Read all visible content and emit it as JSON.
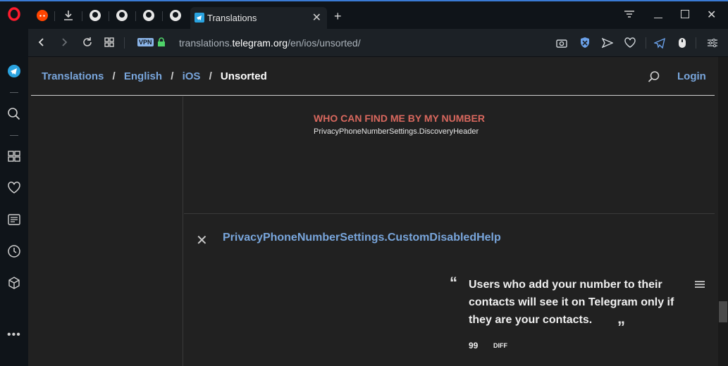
{
  "browser": {
    "tab_title": "Translations",
    "url_prefix": "translations.",
    "url_domain": "telegram.org",
    "url_path": "/en/ios/unsorted/",
    "vpn_label": "VPN"
  },
  "page": {
    "breadcrumb": [
      {
        "label": "Translations",
        "kind": "link"
      },
      {
        "label": "English",
        "kind": "link"
      },
      {
        "label": "iOS",
        "kind": "link"
      },
      {
        "label": "Unsorted",
        "kind": "current"
      }
    ],
    "breadcrumb_sep": "/",
    "login_label": "Login",
    "header_entry": {
      "title": "WHO CAN FIND ME BY MY NUMBER",
      "key": "PrivacyPhoneNumberSettings.DiscoveryHeader"
    },
    "entry": {
      "key": "PrivacyPhoneNumberSettings.CustomDisabledHelp",
      "quote_open": "“",
      "quote_close": "”",
      "text": "Users who add your number to their contacts will see it on Telegram only if they are your contacts.",
      "votes": "99",
      "diff_label": "DIFF"
    }
  },
  "colors": {
    "link": "#79a6dc",
    "header_key": "#d9685e",
    "background": "#212121"
  }
}
